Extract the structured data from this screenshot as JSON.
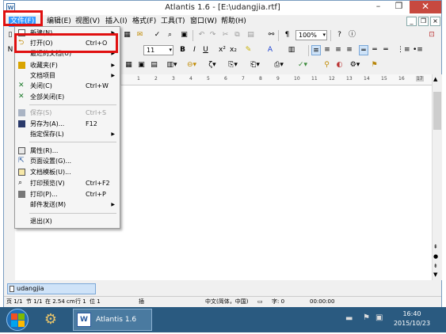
{
  "window": {
    "title": "Atlantis 1.6 - [E:\\udangjia.rtf]",
    "app_icon": "W",
    "controls": {
      "minimize": "–",
      "restore": "❐",
      "close": "✕"
    }
  },
  "menubar": {
    "items": [
      "文件(F)",
      "编辑(E)",
      "视图(V)",
      "插入(I)",
      "格式(F)",
      "工具(T)",
      "窗口(W)",
      "帮助(H)"
    ],
    "mdi": {
      "minimize": "_",
      "restore": "❐",
      "close": "×"
    }
  },
  "toolbar": {
    "zoom": "100%",
    "font_size": "11",
    "bold": "B",
    "italic": "I",
    "underline": "U",
    "paragraph": "¶"
  },
  "file_menu": {
    "items": [
      {
        "label": "新建(N)",
        "shortcut": "",
        "submenu": true,
        "disabled": false,
        "icon": "new-doc-icon"
      },
      {
        "label": "打开(O)",
        "shortcut": "Ctrl+O",
        "submenu": false,
        "disabled": false,
        "icon": "open-folder-icon"
      },
      {
        "label": "最近的文档(U)",
        "shortcut": "",
        "submenu": true,
        "disabled": false,
        "icon": ""
      },
      {
        "label": "收藏夹(F)",
        "shortcut": "",
        "submenu": true,
        "disabled": false,
        "icon": "favorites-icon"
      },
      {
        "label": "文档项目",
        "shortcut": "",
        "submenu": true,
        "disabled": false,
        "icon": ""
      },
      {
        "label": "关闭(C)",
        "shortcut": "Ctrl+W",
        "submenu": false,
        "disabled": false,
        "icon": "close-doc-icon"
      },
      {
        "label": "全部关闭(E)",
        "shortcut": "",
        "submenu": false,
        "disabled": false,
        "icon": "close-all-icon"
      },
      {
        "label": "保存(S)",
        "shortcut": "Ctrl+S",
        "submenu": false,
        "disabled": true,
        "icon": "save-icon"
      },
      {
        "label": "另存为(A)...",
        "shortcut": "F12",
        "submenu": false,
        "disabled": false,
        "icon": "save-as-icon"
      },
      {
        "label": "指定保存(L)",
        "shortcut": "",
        "submenu": true,
        "disabled": false,
        "icon": ""
      },
      {
        "label": "属性(R)...",
        "shortcut": "",
        "submenu": false,
        "disabled": false,
        "icon": "properties-icon"
      },
      {
        "label": "页面设置(G)...",
        "shortcut": "",
        "submenu": false,
        "disabled": false,
        "icon": "page-setup-icon"
      },
      {
        "label": "文档模板(U)...",
        "shortcut": "",
        "submenu": false,
        "disabled": false,
        "icon": "template-icon"
      },
      {
        "label": "打印预览(V)",
        "shortcut": "Ctrl+F2",
        "submenu": false,
        "disabled": false,
        "icon": "print-preview-icon"
      },
      {
        "label": "打印(P)...",
        "shortcut": "Ctrl+P",
        "submenu": false,
        "disabled": false,
        "icon": "print-icon"
      },
      {
        "label": "邮件发送(M)",
        "shortcut": "",
        "submenu": true,
        "disabled": false,
        "icon": ""
      },
      {
        "label": "退出(X)",
        "shortcut": "",
        "submenu": false,
        "disabled": false,
        "icon": ""
      }
    ]
  },
  "ruler": {
    "ticks": [
      "1",
      "2",
      "3",
      "4",
      "5",
      "6",
      "7",
      "8",
      "9",
      "10",
      "11",
      "12",
      "13",
      "14",
      "15",
      "16",
      "17"
    ]
  },
  "document_tab": {
    "label": "udangjia"
  },
  "statusbar": {
    "page": "页 1/1",
    "section": "节 1/1",
    "position": "在 2.54 cm",
    "line": "行 1",
    "column": "位 1",
    "mode": "插",
    "language": "中文(简体，中国)",
    "words": "字: 0",
    "time": "00:00:00"
  },
  "taskbar": {
    "app_label": "Atlantis 1.6",
    "time": "16:40",
    "date": "2015/10/23"
  },
  "colors": {
    "highlight_red": "#e01010",
    "menu_active": "#3399ff",
    "taskbar": "#2a5a80"
  }
}
